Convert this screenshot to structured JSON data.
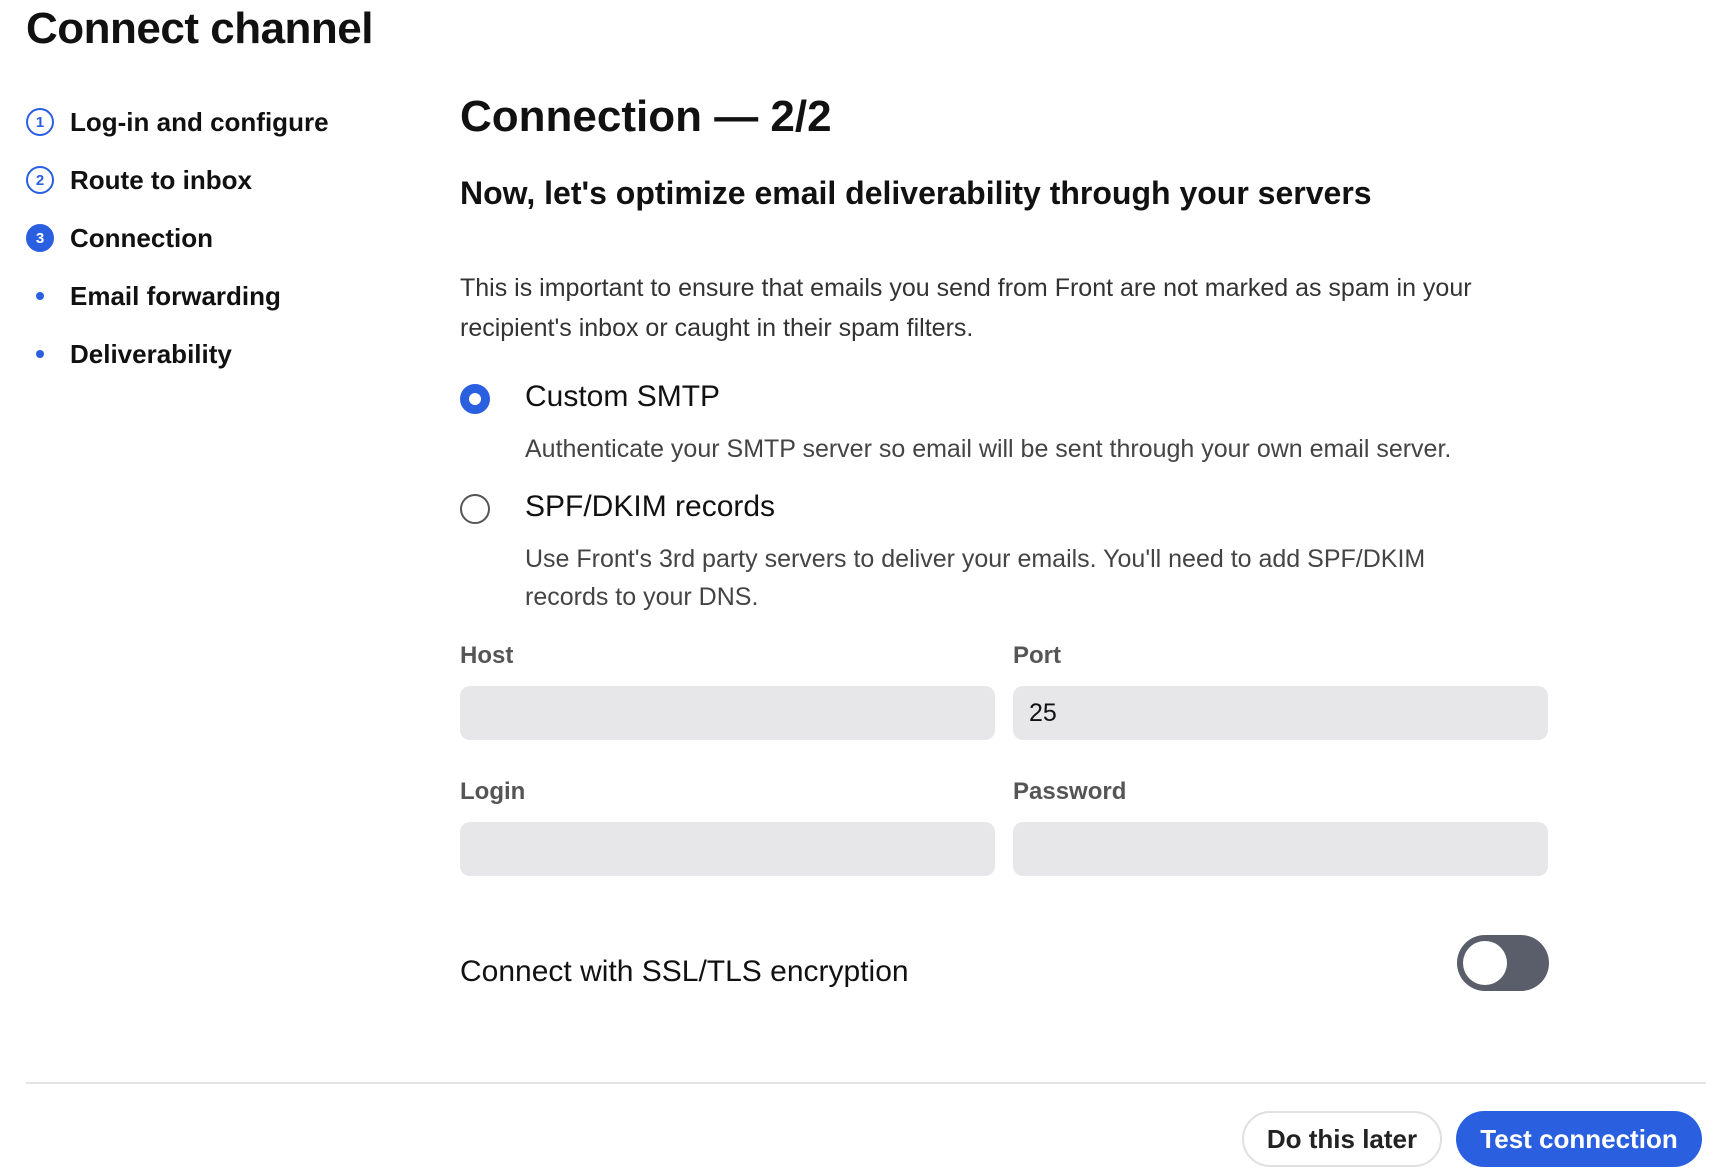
{
  "page": {
    "title": "Connect channel"
  },
  "steps": [
    {
      "marker": "1",
      "label": "Log-in and configure"
    },
    {
      "marker": "2",
      "label": "Route to inbox"
    },
    {
      "marker": "3",
      "label": "Connection"
    },
    {
      "marker": "",
      "label": "Email forwarding"
    },
    {
      "marker": "",
      "label": "Deliverability"
    }
  ],
  "main": {
    "title": "Connection — 2/2",
    "subtitle": "Now, let's optimize email deliverability through your servers",
    "intro": "This is important to ensure that emails you send from Front are not marked as spam in your recipient's inbox or caught in their spam filters.",
    "options": [
      {
        "title": "Custom SMTP",
        "description": "Authenticate your SMTP server so email will be sent through your own email server.",
        "selected": true
      },
      {
        "title": "SPF/DKIM records",
        "description": "Use Front's 3rd party servers to deliver your emails. You'll need to add SPF/DKIM records to your DNS.",
        "selected": false
      }
    ],
    "fields": {
      "host": {
        "label": "Host",
        "value": ""
      },
      "port": {
        "label": "Port",
        "value": "25"
      },
      "login": {
        "label": "Login",
        "value": ""
      },
      "password": {
        "label": "Password",
        "value": ""
      }
    },
    "ssl": {
      "label": "Connect with SSL/TLS encryption",
      "enabled": false
    }
  },
  "footer": {
    "later_label": "Do this later",
    "test_label": "Test connection"
  },
  "colors": {
    "accent": "#2a5fe0",
    "input_bg": "#e7e7e9",
    "toggle_off": "#5a5e6b"
  }
}
